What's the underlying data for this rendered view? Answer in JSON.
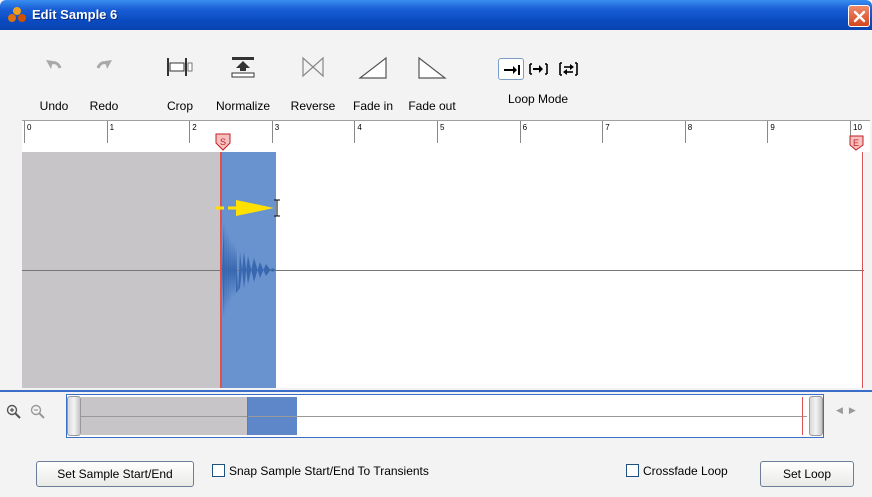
{
  "window": {
    "title": "Edit Sample 6"
  },
  "toolbar": {
    "undo": "Undo",
    "redo": "Redo",
    "crop": "Crop",
    "normalize": "Normalize",
    "reverse": "Reverse",
    "fade_in": "Fade in",
    "fade_out": "Fade out",
    "loop_mode": "Loop Mode"
  },
  "ruler": {
    "ticks": [
      "0",
      "1",
      "2",
      "3",
      "4",
      "5",
      "6",
      "7",
      "8",
      "9",
      "10"
    ],
    "start_marker": "S",
    "end_marker": "E"
  },
  "footer": {
    "set_start_end": "Set Sample Start/End",
    "snap_label": "Snap Sample Start/End To Transients",
    "crossfade_label": "Crossfade Loop",
    "set_loop": "Set Loop"
  },
  "colors": {
    "selection": "#6893cf",
    "inactive_region": "#c8c5c8",
    "marker": "#e05050",
    "arrow": "#ffff00"
  }
}
